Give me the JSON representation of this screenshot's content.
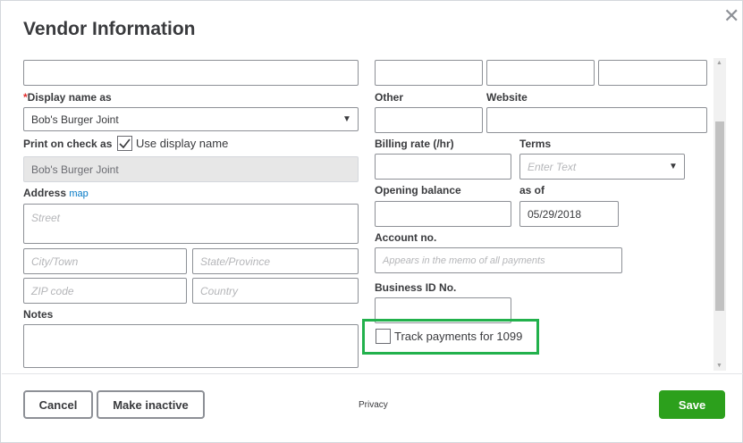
{
  "dialog": {
    "title": "Vendor Information",
    "close_icon": "close-icon"
  },
  "left": {
    "top_field_value": "",
    "display_name_label": "Display name as",
    "required_marker": "*",
    "display_name_value": "Bob's Burger Joint",
    "print_on_check_label": "Print on check as",
    "use_display_name_label": "Use display name",
    "use_display_name_checked": true,
    "print_on_check_value": "Bob's Burger Joint",
    "address_label": "Address",
    "map_link": "map",
    "street_placeholder": "Street",
    "city_placeholder": "City/Town",
    "state_placeholder": "State/Province",
    "zip_placeholder": "ZIP code",
    "country_placeholder": "Country",
    "notes_label": "Notes",
    "notes_value": ""
  },
  "right": {
    "other_label": "Other",
    "website_label": "Website",
    "billing_rate_label": "Billing rate (/hr)",
    "terms_label": "Terms",
    "terms_placeholder": "Enter Text",
    "opening_balance_label": "Opening balance",
    "as_of_label": "as of",
    "as_of_value": "05/29/2018",
    "account_no_label": "Account no.",
    "account_no_placeholder": "Appears in the memo of all payments",
    "business_id_label": "Business ID No.",
    "track_1099_label": "Track payments for 1099",
    "track_1099_checked": false
  },
  "footer": {
    "cancel_label": "Cancel",
    "make_inactive_label": "Make inactive",
    "privacy_label": "Privacy",
    "save_label": "Save"
  },
  "colors": {
    "primary_green": "#2ca01c",
    "highlight_green": "#22b14c",
    "link_blue": "#0077c5",
    "required_red": "#e22c2c"
  }
}
